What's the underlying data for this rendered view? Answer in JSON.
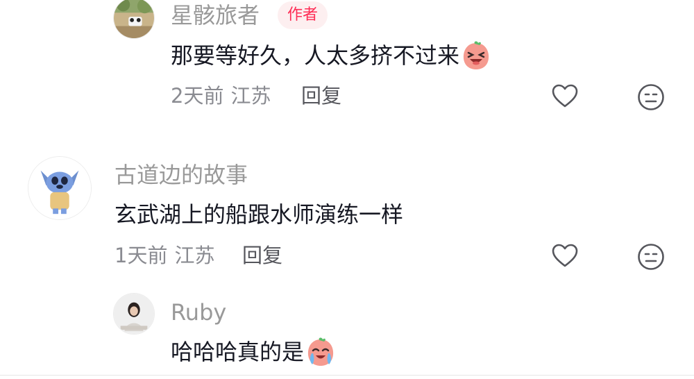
{
  "comments": [
    {
      "username": "星骸旅者",
      "badge": "作者",
      "text": "那要等好久，人太多挤不过来",
      "emoji": "squint-laughing-face-emoji",
      "time": "2天前",
      "location": "江苏",
      "reply_label": "回复",
      "avatar": "scenic-photo-avatar"
    },
    {
      "username": "古道边的故事",
      "text": "玄武湖上的船跟水师演练一样",
      "time": "1天前",
      "location": "江苏",
      "reply_label": "回复",
      "avatar": "cartoon-alien-avatar"
    },
    {
      "username": "Ruby",
      "text": "哈哈哈真的是",
      "emoji": "crying-laughing-face-emoji",
      "avatar": "girl-photo-avatar"
    }
  ],
  "colors": {
    "badge_text": "#fe2c55",
    "badge_bg": "#fdeff0",
    "name": "#999999",
    "body_text": "#161823",
    "meta": "#8a8b91"
  },
  "icons": [
    "heart-icon",
    "dislike-face-icon"
  ]
}
